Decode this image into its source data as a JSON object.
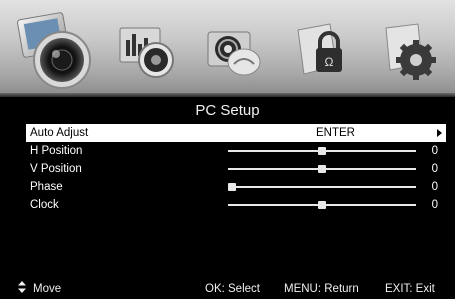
{
  "tabs": [
    {
      "icon": "picture-icon",
      "active": true
    },
    {
      "icon": "sound-icon",
      "active": false
    },
    {
      "icon": "channel-icon",
      "active": false
    },
    {
      "icon": "lock-icon",
      "active": false
    },
    {
      "icon": "setup-gear-icon",
      "active": false
    }
  ],
  "menu": {
    "title": "PC Setup",
    "items": [
      {
        "label": "Auto Adjust",
        "value": "ENTER",
        "selected": true
      },
      {
        "label": "H Position",
        "value": "0",
        "level": 0.5
      },
      {
        "label": "V Position",
        "value": "0",
        "level": 0.5
      },
      {
        "label": "Phase",
        "value": "0",
        "level": 0.0
      },
      {
        "label": "Clock",
        "value": "0",
        "level": 0.5
      }
    ]
  },
  "footer": {
    "move": "Move",
    "select": "OK: Select",
    "return": "MENU: Return",
    "exit": "EXIT: Exit"
  },
  "colors": {
    "background": "#000000",
    "selection": "#ffffff",
    "text": "#ffffff"
  }
}
